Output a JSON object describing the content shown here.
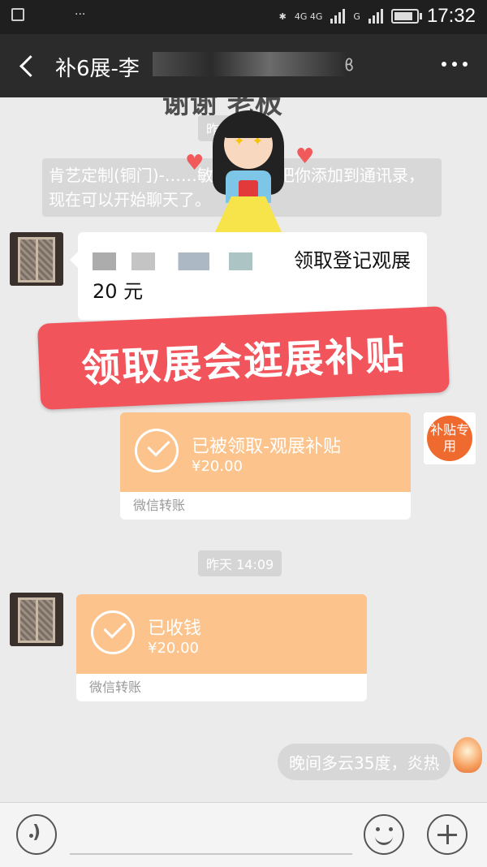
{
  "status_bar": {
    "time": "17:32",
    "network_label": "4G 4G",
    "network2_label": "G"
  },
  "header": {
    "title": "补6展-李",
    "more_icon": "more-dots-icon",
    "back_icon": "back-chevron-icon"
  },
  "chat": {
    "overlay_text": "谢谢  老板",
    "timestamp_top": "昨天",
    "system_message": "肯艺定制(铜门)-……敏相承刚刚把你添加到通讯录，现在可以开始聊天了。",
    "incoming_message": "领取登记观展 20 元",
    "banner_text": "领取展会逛展补贴",
    "transfer_sent": {
      "title": "已被领取-观展补贴",
      "amount": "¥20.00",
      "footer": "微信转账"
    },
    "timestamp_middle": "昨天 14:09",
    "transfer_received": {
      "title": "已收钱",
      "amount": "¥20.00",
      "footer": "微信转账"
    },
    "right_avatar_text": "补贴专用",
    "outgoing_message": "晚间多云35度，炎热"
  },
  "bottom_bar": {
    "voice_icon": "voice-icon",
    "emoji_icon": "emoji-icon",
    "plus_icon": "plus-icon"
  },
  "colors": {
    "header_bg": "#2b2b2b",
    "transfer_orange": "#fcc48c",
    "banner_red": "#f2545b",
    "chat_bg": "#ebebeb"
  }
}
